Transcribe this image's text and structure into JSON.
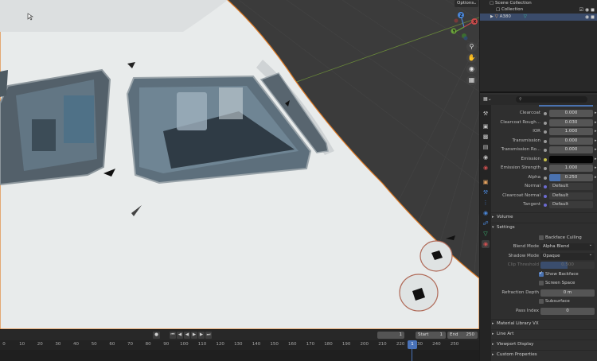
{
  "viewport": {
    "options_label": "Options",
    "nav_icons": [
      "zoom-icon",
      "hand-pan-icon",
      "camera-icon",
      "grid-icon"
    ],
    "gizmo": {
      "x_label": "X",
      "y_label": "Y",
      "z_label": "Z"
    }
  },
  "timeline": {
    "current_frame": "1",
    "start_label": "Start",
    "start_value": "1",
    "end_label": "End",
    "end_value": "250",
    "ticks": [
      "0",
      "10",
      "20",
      "30",
      "40",
      "50",
      "60",
      "70",
      "80",
      "90",
      "100",
      "110",
      "120",
      "130",
      "140",
      "150",
      "160",
      "170",
      "180",
      "190",
      "200",
      "210",
      "220",
      "230",
      "240",
      "250"
    ],
    "playhead_label": "1"
  },
  "outliner": {
    "scene_collection": "Scene Collection",
    "collection": "Collection",
    "object": "A380"
  },
  "properties": {
    "search_placeholder": "",
    "rows": [
      {
        "label": "Clearcoat",
        "value": "0.000"
      },
      {
        "label": "Clearcoat Rough...",
        "value": "0.030"
      },
      {
        "label": "IOR",
        "value": "1.000"
      },
      {
        "label": "Transmission",
        "value": "0.000"
      },
      {
        "label": "Transmission Ro...",
        "value": "0.000"
      },
      {
        "label": "Emission",
        "value": ""
      },
      {
        "label": "Emission Strength",
        "value": "1.000"
      },
      {
        "label": "Alpha",
        "value": "0.250"
      },
      {
        "label": "Normal",
        "value": "Default"
      },
      {
        "label": "Clearcoat Normal",
        "value": "Default"
      },
      {
        "label": "Tangent",
        "value": "Default"
      }
    ],
    "sections": {
      "volume": "Volume",
      "settings": "Settings",
      "material_library": "Material Library VX",
      "line_art": "Line Art",
      "viewport_display": "Viewport Display",
      "custom_properties": "Custom Properties"
    },
    "settings": {
      "backface_culling": "Backface Culling",
      "blend_mode_label": "Blend Mode",
      "blend_mode_value": "Alpha Blend",
      "shadow_mode_label": "Shadow Mode",
      "shadow_mode_value": "Opaque",
      "clip_threshold_label": "Clip Threshold",
      "clip_threshold_value": "0.500",
      "show_backface": "Show Backface",
      "screen_space_refraction": "Screen Space Refraction",
      "refraction_depth_label": "Refraction Depth",
      "refraction_depth_value": "0 m",
      "subsurface_translucency": "Subsurface Translucency",
      "pass_index_label": "Pass Index",
      "pass_index_value": "0"
    }
  },
  "colors": {
    "selection_orange": "#e07b25",
    "accent_blue": "#4a72b0",
    "fuselage_white": "#e9ecec",
    "grid_background": "#3b3b3b"
  }
}
